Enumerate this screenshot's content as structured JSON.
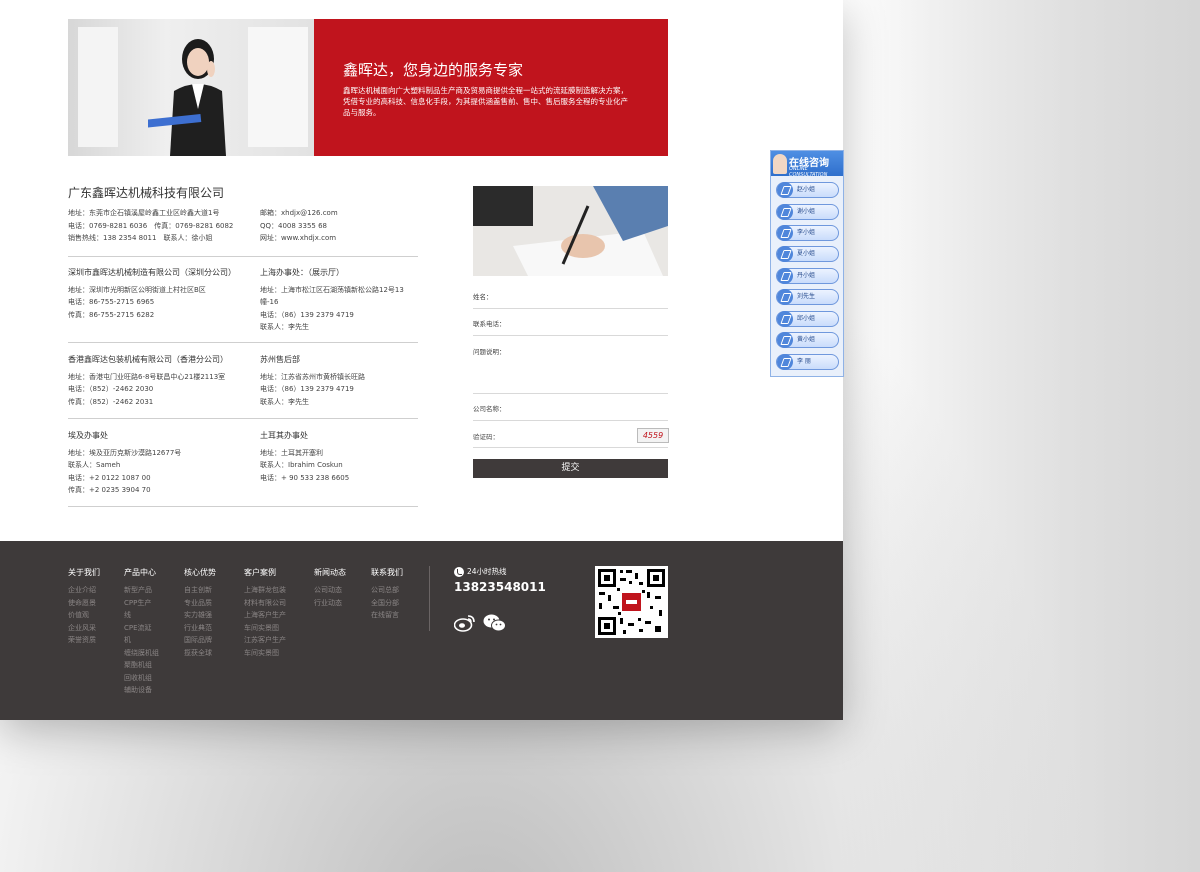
{
  "banner": {
    "title": "鑫晖达，您身边的服务专家",
    "description": "鑫晖达机械面向广大塑料制品生产商及贸易商提供全程一站式的流延膜制造解决方案，凭借专业的高科技、信息化手段，为其提供涵盖售前、售中、售后服务全程的专业化产品与服务。"
  },
  "company_title": "广东鑫晖达机械科技有限公司",
  "offices": [
    {
      "name": "",
      "lines": [
        "地址：东莞市企石镇溪屋岭鑫工业区岭鑫大道1号",
        "电话：0769-8281 6036　传真：0769-8281 6082",
        "销售热线：138 2354 8011　联系人：徐小姐"
      ]
    },
    {
      "name": "",
      "lines": [
        "邮箱：xhdjx@126.com",
        "QQ：4008 3355 68",
        "网址：www.xhdjx.com"
      ]
    },
    {
      "name": "深圳市鑫晖达机械制造有限公司（深圳分公司）",
      "lines": [
        "地址：深圳市光明新区公明街道上村社区B区",
        "电话：86-755-2715 6965",
        "传真：86-755-2715 6282"
      ]
    },
    {
      "name": "上海办事处：（展示厅）",
      "lines": [
        "地址：上海市松江区石湖荡镇新松公路12号13",
        "幢-16",
        "电话：（86）139 2379 4719",
        "联系人：李先生"
      ]
    },
    {
      "name": "香港鑫晖达包装机械有限公司（香港分公司）",
      "lines": [
        "地址：香港屯门业旺路6-8号联昌中心21楼2113室",
        "电话：（852）-2462 2030",
        "传真：（852）-2462 2031"
      ]
    },
    {
      "name": "苏州售后部",
      "lines": [
        "地址：江苏省苏州市黄桥镇长旺路",
        "电话：（86）139 2379 4719",
        "联系人：李先生"
      ]
    },
    {
      "name": "埃及办事处",
      "lines": [
        "地址：埃及亚历克斯沙漠路12677号",
        "联系人：Sameh",
        "电话：+2 0122 1087 00",
        "传真：+2 0235 3904 70"
      ]
    },
    {
      "name": "土耳其办事处",
      "lines": [
        "地址：土耳其开塞利",
        "联系人：Ibrahim Coskun",
        "电话：+ 90 533 238 6605"
      ]
    }
  ],
  "form": {
    "name_label": "姓名：",
    "phone_label": "联系电话：",
    "question_label": "问题说明：",
    "company_label": "公司名称：",
    "captcha_label": "验证码：",
    "captcha_value": "4559",
    "submit_label": "提交"
  },
  "footer": {
    "columns": [
      {
        "head": "关于我们",
        "items": [
          "企业介绍",
          "使命愿景",
          "价值观",
          "企业风采",
          "荣誉资质"
        ]
      },
      {
        "head": "产品中心",
        "items": [
          "新型产品",
          "CPP生产",
          "线",
          "CPE流延",
          "机",
          "缠绕膜机组",
          "聚酯机组",
          "回收机组",
          "辅助设备"
        ]
      },
      {
        "head": "核心优势",
        "items": [
          "自主创新",
          "专业品质",
          "实力雄强",
          "行业典范",
          "国际品牌",
          "揽获全球"
        ]
      },
      {
        "head": "客户案例",
        "items": [
          "上海群龙包装",
          "材料有限公司",
          "上海客户生产",
          "车间实景图",
          "江苏客户生产",
          "车间实景图"
        ]
      },
      {
        "head": "新闻动态",
        "items": [
          "公司动态",
          "行业动态"
        ]
      },
      {
        "head": "联系我们",
        "items": [
          "公司总部",
          "全国分部",
          "在线留言"
        ]
      }
    ],
    "hotline_label": "24小时热线",
    "hotline_number": "13823548011"
  },
  "side_widget": {
    "title": "在线咨询",
    "subtitle": "ONLINE CONSULTATION",
    "agents": [
      "赵小姐",
      "谢小姐",
      "李小姐",
      "夏小姐",
      "丹小姐",
      "刘先生",
      "邱小姐",
      "黄小姐",
      "李 丽"
    ]
  },
  "colors": {
    "accent_red": "#c0141d",
    "footer_bg": "#3e3a3a",
    "submit_bg": "#3f3a3a",
    "widget_blue": "#2f6fcc"
  }
}
